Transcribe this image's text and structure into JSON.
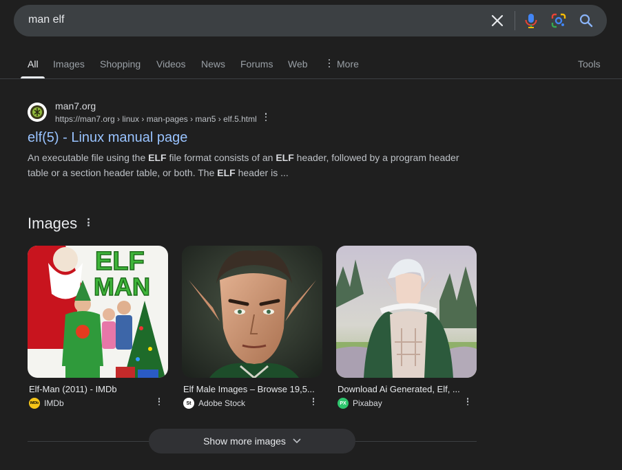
{
  "search": {
    "query": "man elf"
  },
  "tabs": [
    {
      "label": "All"
    },
    {
      "label": "Images"
    },
    {
      "label": "Shopping"
    },
    {
      "label": "Videos"
    },
    {
      "label": "News"
    },
    {
      "label": "Forums"
    },
    {
      "label": "Web"
    },
    {
      "label": "More"
    },
    {
      "label": "Tools"
    }
  ],
  "result": {
    "site_name": "man7.org",
    "url": "https://man7.org › linux › man-pages › man5 › elf.5.html",
    "title": "elf(5) - Linux manual page",
    "snippet_parts": [
      "An executable file using the ",
      "ELF",
      " file format consists of an ",
      "ELF",
      " header, followed by a program header table or a section header table, or both. The ",
      "ELF",
      " header is ..."
    ]
  },
  "images_section": {
    "heading": "Images",
    "cards": [
      {
        "caption": "Elf-Man (2011) - IMDb",
        "source": "IMDb",
        "logo_text": "IMDb",
        "logo_color": "#f5c518"
      },
      {
        "caption": "Elf Male Images – Browse 19,5...",
        "source": "Adobe Stock",
        "logo_text": "St",
        "logo_color": "#ffffff"
      },
      {
        "caption": "Download Ai Generated, Elf, ...",
        "source": "Pixabay",
        "logo_text": "PX",
        "logo_color": "#2ec66d"
      }
    ],
    "show_more_label": "Show more images"
  },
  "colors": {
    "background": "#1f1f1f",
    "link": "#99c3ff",
    "search_bar": "#3c4043"
  },
  "icons": [
    "close-icon",
    "microphone-icon",
    "lens-icon",
    "search-icon",
    "more-vert-icon",
    "chevron-down-icon"
  ]
}
